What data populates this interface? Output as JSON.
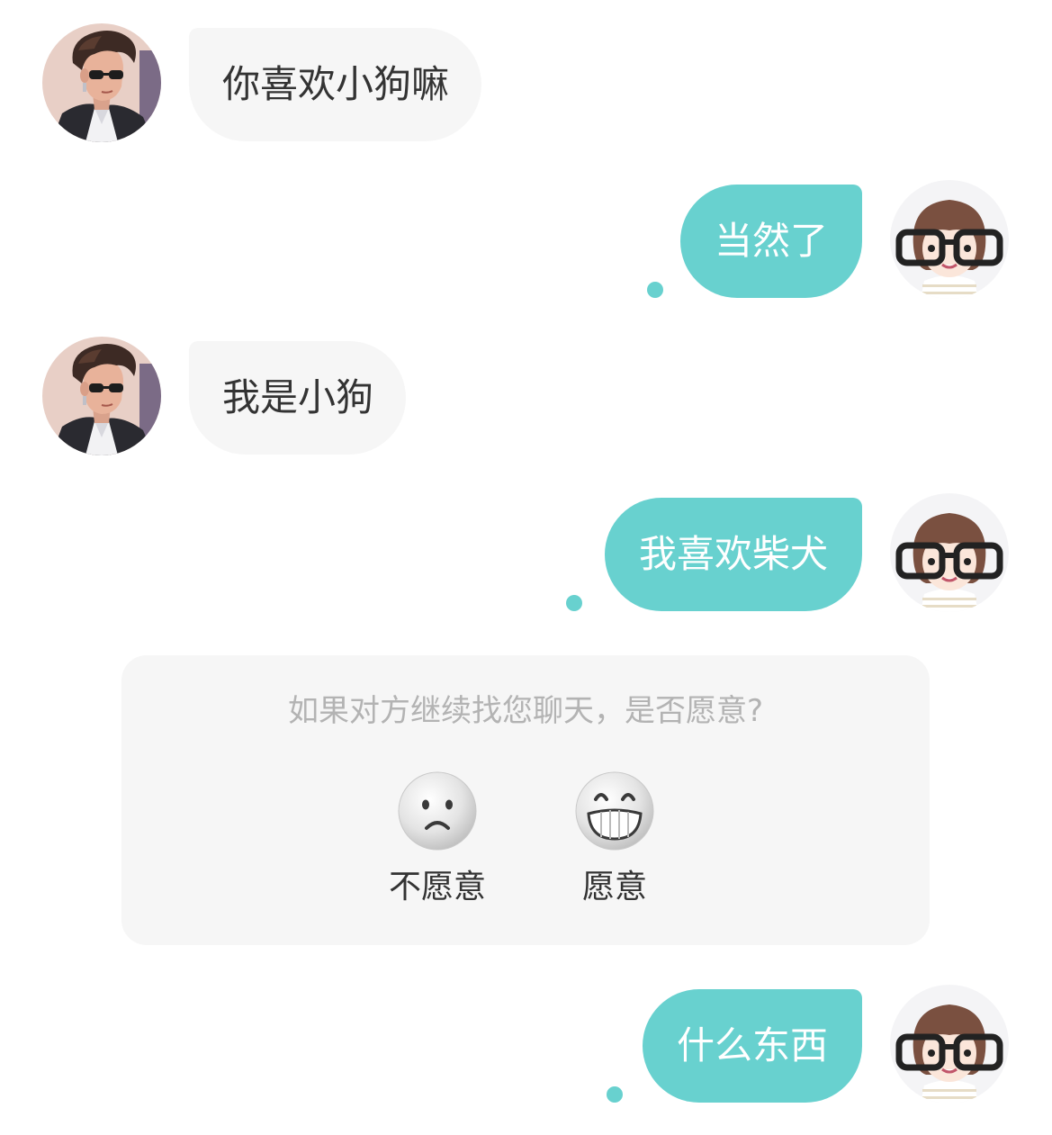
{
  "messages": [
    {
      "side": "left",
      "sender": "other",
      "text": "你喜欢小狗嘛"
    },
    {
      "side": "right",
      "sender": "self",
      "text": "当然了"
    },
    {
      "side": "left",
      "sender": "other",
      "text": "我是小狗"
    },
    {
      "side": "right",
      "sender": "self",
      "text": "我喜欢柴犬"
    },
    {
      "side": "right",
      "sender": "self",
      "text": "什么东西"
    }
  ],
  "prompt": {
    "question": "如果对方继续找您聊天，是否愿意?",
    "options": [
      {
        "label": "不愿意",
        "icon": "sad-face-icon"
      },
      {
        "label": "愿意",
        "icon": "grinning-face-icon"
      }
    ]
  },
  "colors": {
    "self_bubble": "#68d1cf",
    "other_bubble": "#f6f6f6",
    "self_text": "#ffffff",
    "other_text": "#333333",
    "prompt_text": "#b3b3b3",
    "card_background": "#f6f6f6"
  },
  "icons": {
    "other_avatar": "man-sunglasses-avatar",
    "self_avatar": "girl-glasses-avatar"
  }
}
